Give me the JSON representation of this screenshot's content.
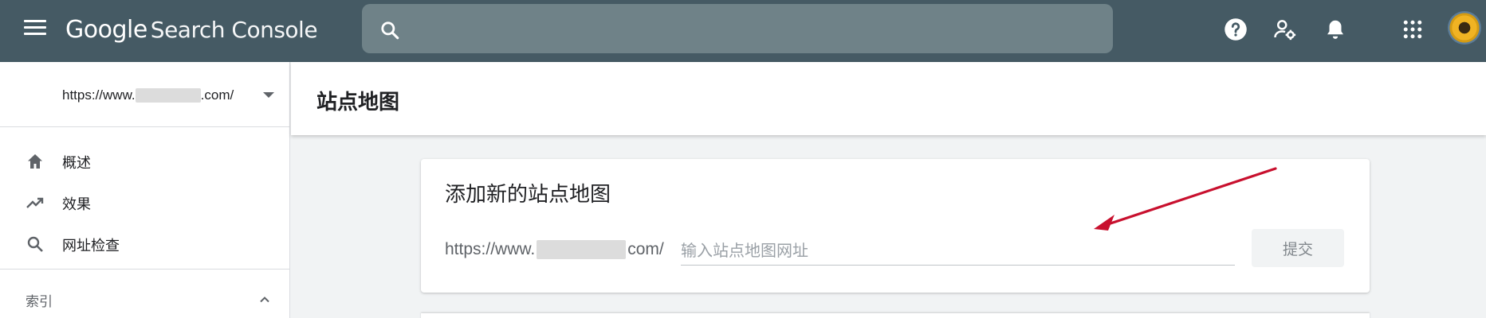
{
  "header": {
    "logo_google": "Google",
    "logo_product": "Search Console",
    "search_placeholder": ""
  },
  "icons": {
    "menu": "hamburger-menu-icon",
    "search": "search-icon",
    "help": "help-icon",
    "account_settings": "manage-users-icon",
    "notifications": "bell-icon",
    "apps": "apps-grid-icon",
    "avatar": "sunflower-avatar"
  },
  "sidebar": {
    "property_url_start": "https://www.",
    "property_url_end": ".com/",
    "items": [
      {
        "label": "概述",
        "icon": "home-icon"
      },
      {
        "label": "效果",
        "icon": "trending-up-icon"
      },
      {
        "label": "网址检查",
        "icon": "search-icon"
      }
    ],
    "section_label": "索引"
  },
  "main": {
    "page_title": "站点地图",
    "card": {
      "title": "添加新的站点地图",
      "url_prefix_start": "https://www.",
      "url_prefix_end": "com/",
      "input_placeholder": "输入站点地图网址",
      "submit_label": "提交"
    }
  },
  "colors": {
    "topbar": "#455a64",
    "search_bg": "#6f8288",
    "annotation_arrow": "#c8102e"
  }
}
